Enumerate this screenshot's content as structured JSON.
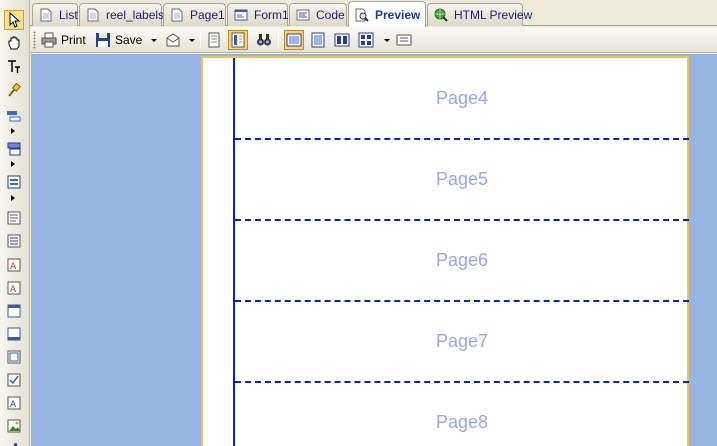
{
  "tabs": [
    {
      "label": "List",
      "icon": "document-icon"
    },
    {
      "label": "reel_labels",
      "icon": "document-icon"
    },
    {
      "label": "Page1",
      "icon": "document-icon"
    },
    {
      "label": "Form1",
      "icon": "form-icon"
    },
    {
      "label": "Code",
      "icon": "code-icon"
    },
    {
      "label": "Preview",
      "icon": "magnifier-icon",
      "active": true
    },
    {
      "label": "HTML Preview",
      "icon": "globe-magnifier-icon"
    }
  ],
  "toolbar": {
    "print_label": "Print",
    "save_label": "Save"
  },
  "preview": {
    "bands": [
      "Page4",
      "Page5",
      "Page6",
      "Page7",
      "Page8"
    ]
  },
  "colors": {
    "workspace": "#98b4e0",
    "band_border": "#0b20c0",
    "band_text": "#9aa6e2",
    "page_border": "#f4c440",
    "pressed": "#ffd27a"
  }
}
